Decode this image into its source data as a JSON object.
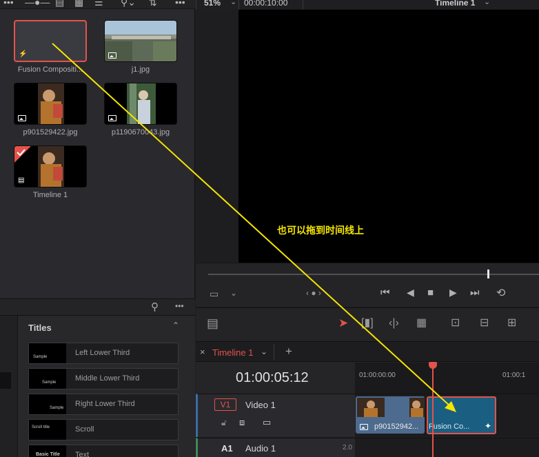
{
  "media_pool": {
    "clips": [
      {
        "name": "Fusion Compositi...",
        "kind": "fusion"
      },
      {
        "name": "j1.jpg",
        "kind": "image"
      },
      {
        "name": "p901529422.jpg",
        "kind": "image"
      },
      {
        "name": "p1190670043.jpg",
        "kind": "image"
      },
      {
        "name": "Timeline 1",
        "kind": "timeline"
      }
    ]
  },
  "viewer": {
    "zoom": "51%",
    "timecode": "00:00:10:00",
    "timeline_name": "Timeline 1"
  },
  "effects": {
    "section_title": "Titles",
    "items": [
      {
        "label": "Left Lower Third",
        "thumb": "Sample"
      },
      {
        "label": "Middle Lower Third",
        "thumb": "Sample"
      },
      {
        "label": "Right Lower Third",
        "thumb": "Sample"
      },
      {
        "label": "Scroll",
        "thumb": "Scroll title"
      },
      {
        "label": "Text",
        "thumb": "Basic Title"
      }
    ]
  },
  "timeline": {
    "tab_name": "Timeline 1",
    "timecode": "01:00:05:12",
    "ruler_start": "01:00:00:00",
    "ruler_next": "01:00:1",
    "video_track": {
      "id": "V1",
      "name": "Video 1"
    },
    "audio_track": {
      "id": "A1",
      "name": "Audio 1",
      "level": "2.0"
    },
    "clips": [
      {
        "label": "p90152942..."
      },
      {
        "label": "Fusion Co..."
      }
    ]
  },
  "annotation": "也可以拖到时间线上",
  "colors": {
    "accent": "#e4534a",
    "annotation": "#f5e600",
    "fusion_clip": "#1a5f82",
    "image_clip": "#4d6b8e"
  }
}
